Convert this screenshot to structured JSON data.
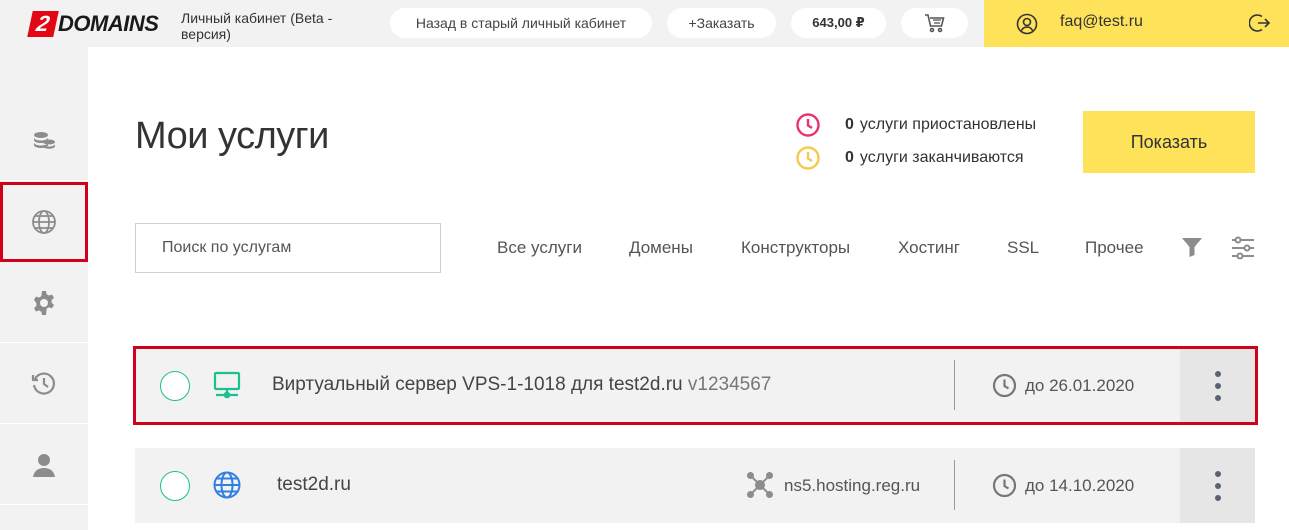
{
  "header": {
    "logo_digit": "2",
    "logo_text": "DOMAINS",
    "cabinet_title": "Личный кабинет (Beta - версия)",
    "old_cabinet_label": "Назад в старый личный кабинет",
    "order_label": "+Заказать",
    "balance": "643,00 ₽",
    "cart_icon": "cart-icon",
    "user_email": "faq@test.ru",
    "accent_color": "#fde25a"
  },
  "sidebar": {
    "items": [
      {
        "icon": "coins-icon",
        "active": false
      },
      {
        "icon": "globe-icon",
        "active": true
      },
      {
        "icon": "gear-icon",
        "active": false
      },
      {
        "icon": "history-icon",
        "active": false
      },
      {
        "icon": "user-icon",
        "active": false
      }
    ]
  },
  "main": {
    "title": "Мои услуги",
    "status": {
      "suspended_count": "0",
      "suspended_label": "услуги приостановлены",
      "expiring_count": "0",
      "expiring_label": "услуги заканчиваются",
      "suspended_color": "#e8336d",
      "expiring_color": "#f7c948"
    },
    "show_label": "Показать",
    "search_placeholder": "Поиск по услугам",
    "tabs": [
      {
        "label": "Все услуги"
      },
      {
        "label": "Домены"
      },
      {
        "label": "Конструкторы"
      },
      {
        "label": "Хостинг"
      },
      {
        "label": "SSL"
      },
      {
        "label": "Прочее"
      }
    ],
    "services": [
      {
        "icon": "server-icon",
        "name": "Виртуальный сервер VPS-1-1018 для test2d.ru",
        "sub": "v1234567",
        "ns": "",
        "date": "до 26.01.2020"
      },
      {
        "icon": "globe-icon",
        "name": "test2d.ru",
        "sub": "",
        "ns": "ns5.hosting.reg.ru",
        "date": "до 14.10.2020"
      }
    ]
  }
}
